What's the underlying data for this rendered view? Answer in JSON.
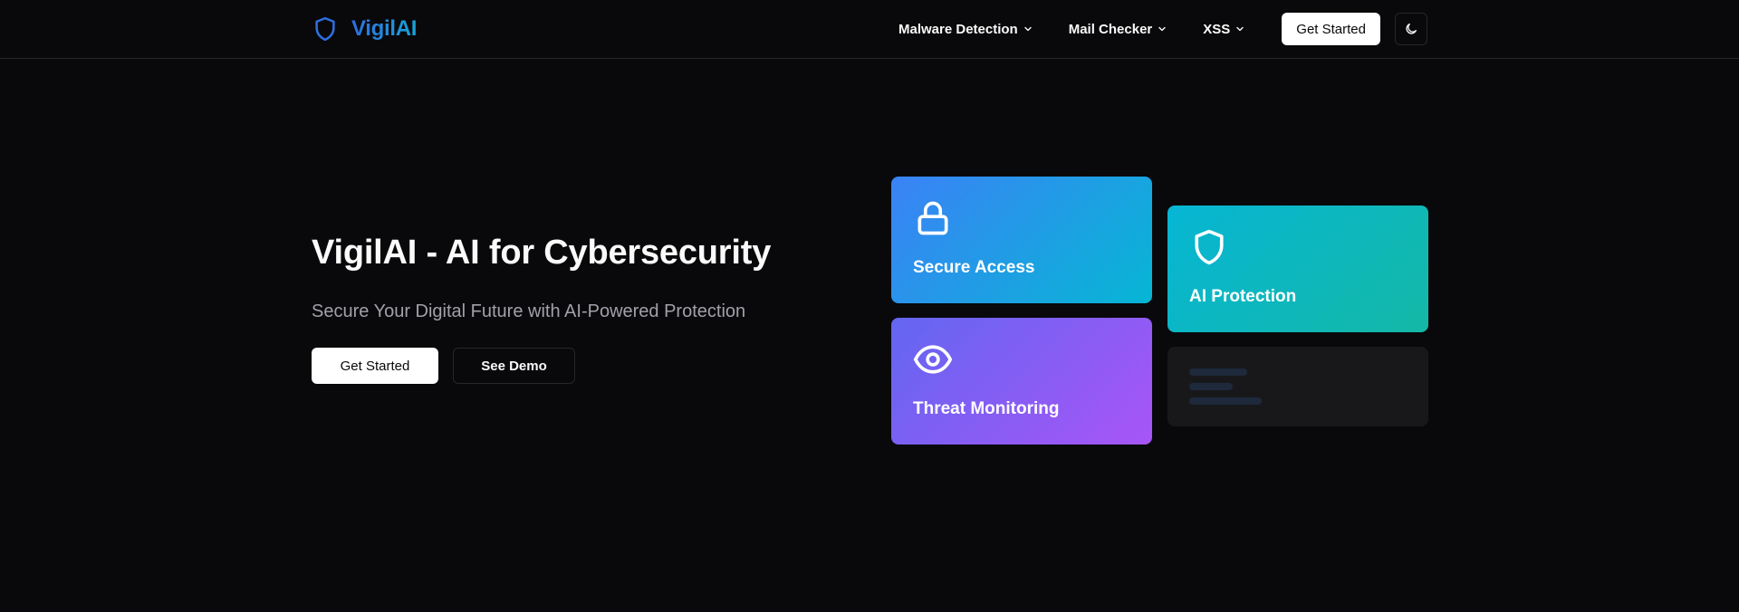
{
  "header": {
    "logo": {
      "icon": "shield-icon",
      "text": "VigilAI",
      "color": "#1f8fd8"
    },
    "nav": [
      {
        "label": "Malware Detection",
        "icon": "chevron-down-icon"
      },
      {
        "label": "Mail Checker",
        "icon": "chevron-down-icon"
      },
      {
        "label": "XSS",
        "icon": "chevron-down-icon"
      }
    ],
    "cta_label": "Get Started",
    "theme_toggle_icon": "moon-icon"
  },
  "hero": {
    "title": "VigilAI - AI for Cybersecurity",
    "subtitle": "Secure Your Digital Future with AI-Powered Protection",
    "primary_button": "Get Started",
    "secondary_button": "See Demo"
  },
  "cards": [
    {
      "label": "Secure Access",
      "icon": "lock-icon",
      "gradient": [
        "#3b82f6",
        "#06b6d4"
      ]
    },
    {
      "label": "AI Protection",
      "icon": "shield-icon",
      "gradient": [
        "#06b6d4",
        "#14b8a6"
      ]
    },
    {
      "label": "Threat Monitoring",
      "icon": "eye-icon",
      "gradient": [
        "#6366f1",
        "#a855f7"
      ]
    }
  ],
  "colors": {
    "background": "#09090b",
    "border": "#27272a",
    "muted_text": "#a1a1aa",
    "skeleton_card": "#18181b",
    "skeleton_line": "#1e293b"
  }
}
